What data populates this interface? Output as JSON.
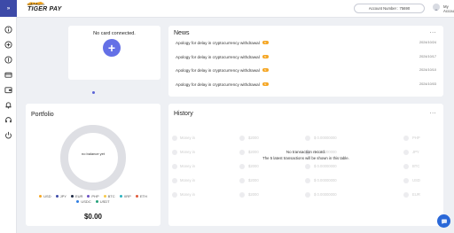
{
  "header": {
    "logo_sub": "Internationale",
    "logo_main": "TIGER PAY",
    "account_number": "Account Number : 75690",
    "my_account": "My Account"
  },
  "sidebar": {
    "top_label": "»",
    "icons": [
      "info-icon",
      "plus-circle-icon",
      "dollar-circle-icon",
      "card-icon",
      "wallet-icon",
      "bell-icon",
      "headset-icon",
      "power-icon"
    ]
  },
  "card": {
    "title": "No card connected.",
    "add_label": "+"
  },
  "news": {
    "title": "News",
    "more": "...",
    "badge": "N",
    "items": [
      {
        "text": "Apology for delay in cryptocurrency withdrawal",
        "date": "2024/10/24"
      },
      {
        "text": "Apology for delay in cryptocurrency withdrawal",
        "date": "2024/10/17"
      },
      {
        "text": "Apology for delay in cryptocurrency withdrawal",
        "date": "2024/10/10"
      },
      {
        "text": "Apology for delay in cryptocurrency withdrawal",
        "date": "2024/10/03"
      }
    ]
  },
  "portfolio": {
    "title": "Portfolio",
    "empty_label": "no balance yet",
    "balance": "$0.00",
    "legend": [
      {
        "label": "USD",
        "color": "#f5a623"
      },
      {
        "label": "JPY",
        "color": "#3d4aa8"
      },
      {
        "label": "EUR",
        "color": "#1f2a44"
      },
      {
        "label": "PHP",
        "color": "#6a4fc2"
      },
      {
        "label": "BTC",
        "color": "#f7c948"
      },
      {
        "label": "XRP",
        "color": "#2bb3c0"
      },
      {
        "label": "ETH",
        "color": "#e05a3a"
      },
      {
        "label": "USDC",
        "color": "#2f7de1"
      },
      {
        "label": "USDT",
        "color": "#26a17b"
      }
    ]
  },
  "history": {
    "title": "History",
    "more": "...",
    "empty_title": "No transaction record.",
    "empty_subtitle": "The 5 latest transactions will be shown in this table.",
    "ghost_rows": [
      {
        "type": "Money in",
        "status": "$2000",
        "amount": "$ 0.00000000",
        "currency": "PHP"
      },
      {
        "type": "Money in",
        "status": "$2000",
        "amount": "$ 0.00000000",
        "currency": "JPY"
      },
      {
        "type": "Money in",
        "status": "$2000",
        "amount": "$ 0.00000000",
        "currency": "BTC"
      },
      {
        "type": "Money in",
        "status": "$2000",
        "amount": "$ 0.00000000",
        "currency": "USD"
      },
      {
        "type": "Money in",
        "status": "$2000",
        "amount": "$ 0.00000000",
        "currency": "EUR"
      }
    ]
  }
}
